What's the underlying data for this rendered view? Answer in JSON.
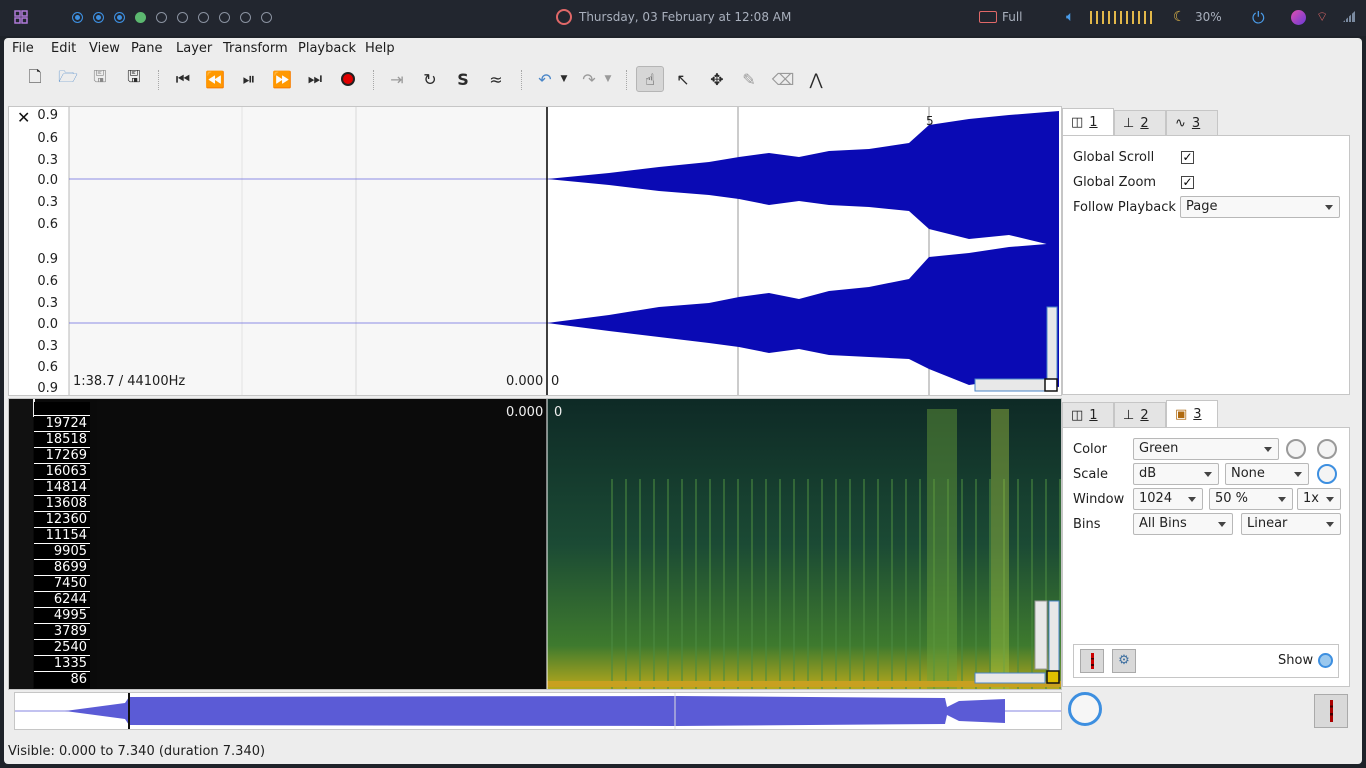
{
  "topbar": {
    "datetime": "Thursday, 03 February at 12:08 AM",
    "battery_label": "Full",
    "brightness": "30%"
  },
  "menu": [
    "File",
    "Edit",
    "View",
    "Pane",
    "Layer",
    "Transform",
    "Playback",
    "Help"
  ],
  "toolbar_icons": [
    "new-file-icon",
    "open-folder-icon",
    "save-icon",
    "save-as-icon",
    "rewind-start-icon",
    "rewind-icon",
    "play-pause-icon",
    "fast-forward-icon",
    "forward-end-icon",
    "record-icon",
    "play-selection-icon",
    "loop-icon",
    "solo-icon",
    "align-icon",
    "undo-icon",
    "undo-menu-icon",
    "redo-icon",
    "redo-menu-icon",
    "navigate-icon",
    "select-icon",
    "move-icon",
    "draw-icon",
    "erase-icon",
    "measure-icon"
  ],
  "waveform": {
    "scale_top": [
      "0.9",
      "0.6",
      "0.3",
      "0.0",
      "0.3",
      "0.6"
    ],
    "scale_bottom": [
      "0.9",
      "0.6",
      "0.3",
      "0.0",
      "0.3",
      "0.6",
      "0.9"
    ],
    "info": "1:38.7 / 44100Hz",
    "time_label": "0.000",
    "start_marker": "0",
    "marker_5": "5"
  },
  "spectrogram": {
    "time_label": "0.000",
    "start_marker": "0",
    "freq_scale": [
      "19724",
      "18518",
      "17269",
      "16063",
      "14814",
      "13608",
      "12360",
      "11154",
      "9905",
      "8699",
      "7450",
      "6244",
      "4995",
      "3789",
      "2540",
      "1335",
      "86"
    ]
  },
  "props_top": {
    "tabs": [
      "1",
      "2",
      "3"
    ],
    "global_scroll_label": "Global Scroll",
    "global_scroll_checked": true,
    "global_zoom_label": "Global Zoom",
    "global_zoom_checked": true,
    "follow_playback_label": "Follow Playback",
    "follow_playback_value": "Page"
  },
  "props_bottom": {
    "tabs": [
      "1",
      "2",
      "3"
    ],
    "color_label": "Color",
    "color_value": "Green",
    "scale_label": "Scale",
    "scale_value": "dB",
    "scale_norm": "None",
    "window_label": "Window",
    "window_size": "1024",
    "window_overlap": "50 %",
    "window_zoom": "1x",
    "bins_label": "Bins",
    "bins_value": "All Bins",
    "bins_scale": "Linear",
    "show_label": "Show"
  },
  "status": "Visible: 0.000 to 7.340 (duration 7.340)",
  "colors": {
    "waveform": "#0a0ab4",
    "overview": "#5b5bd6",
    "record": "#e00000"
  }
}
